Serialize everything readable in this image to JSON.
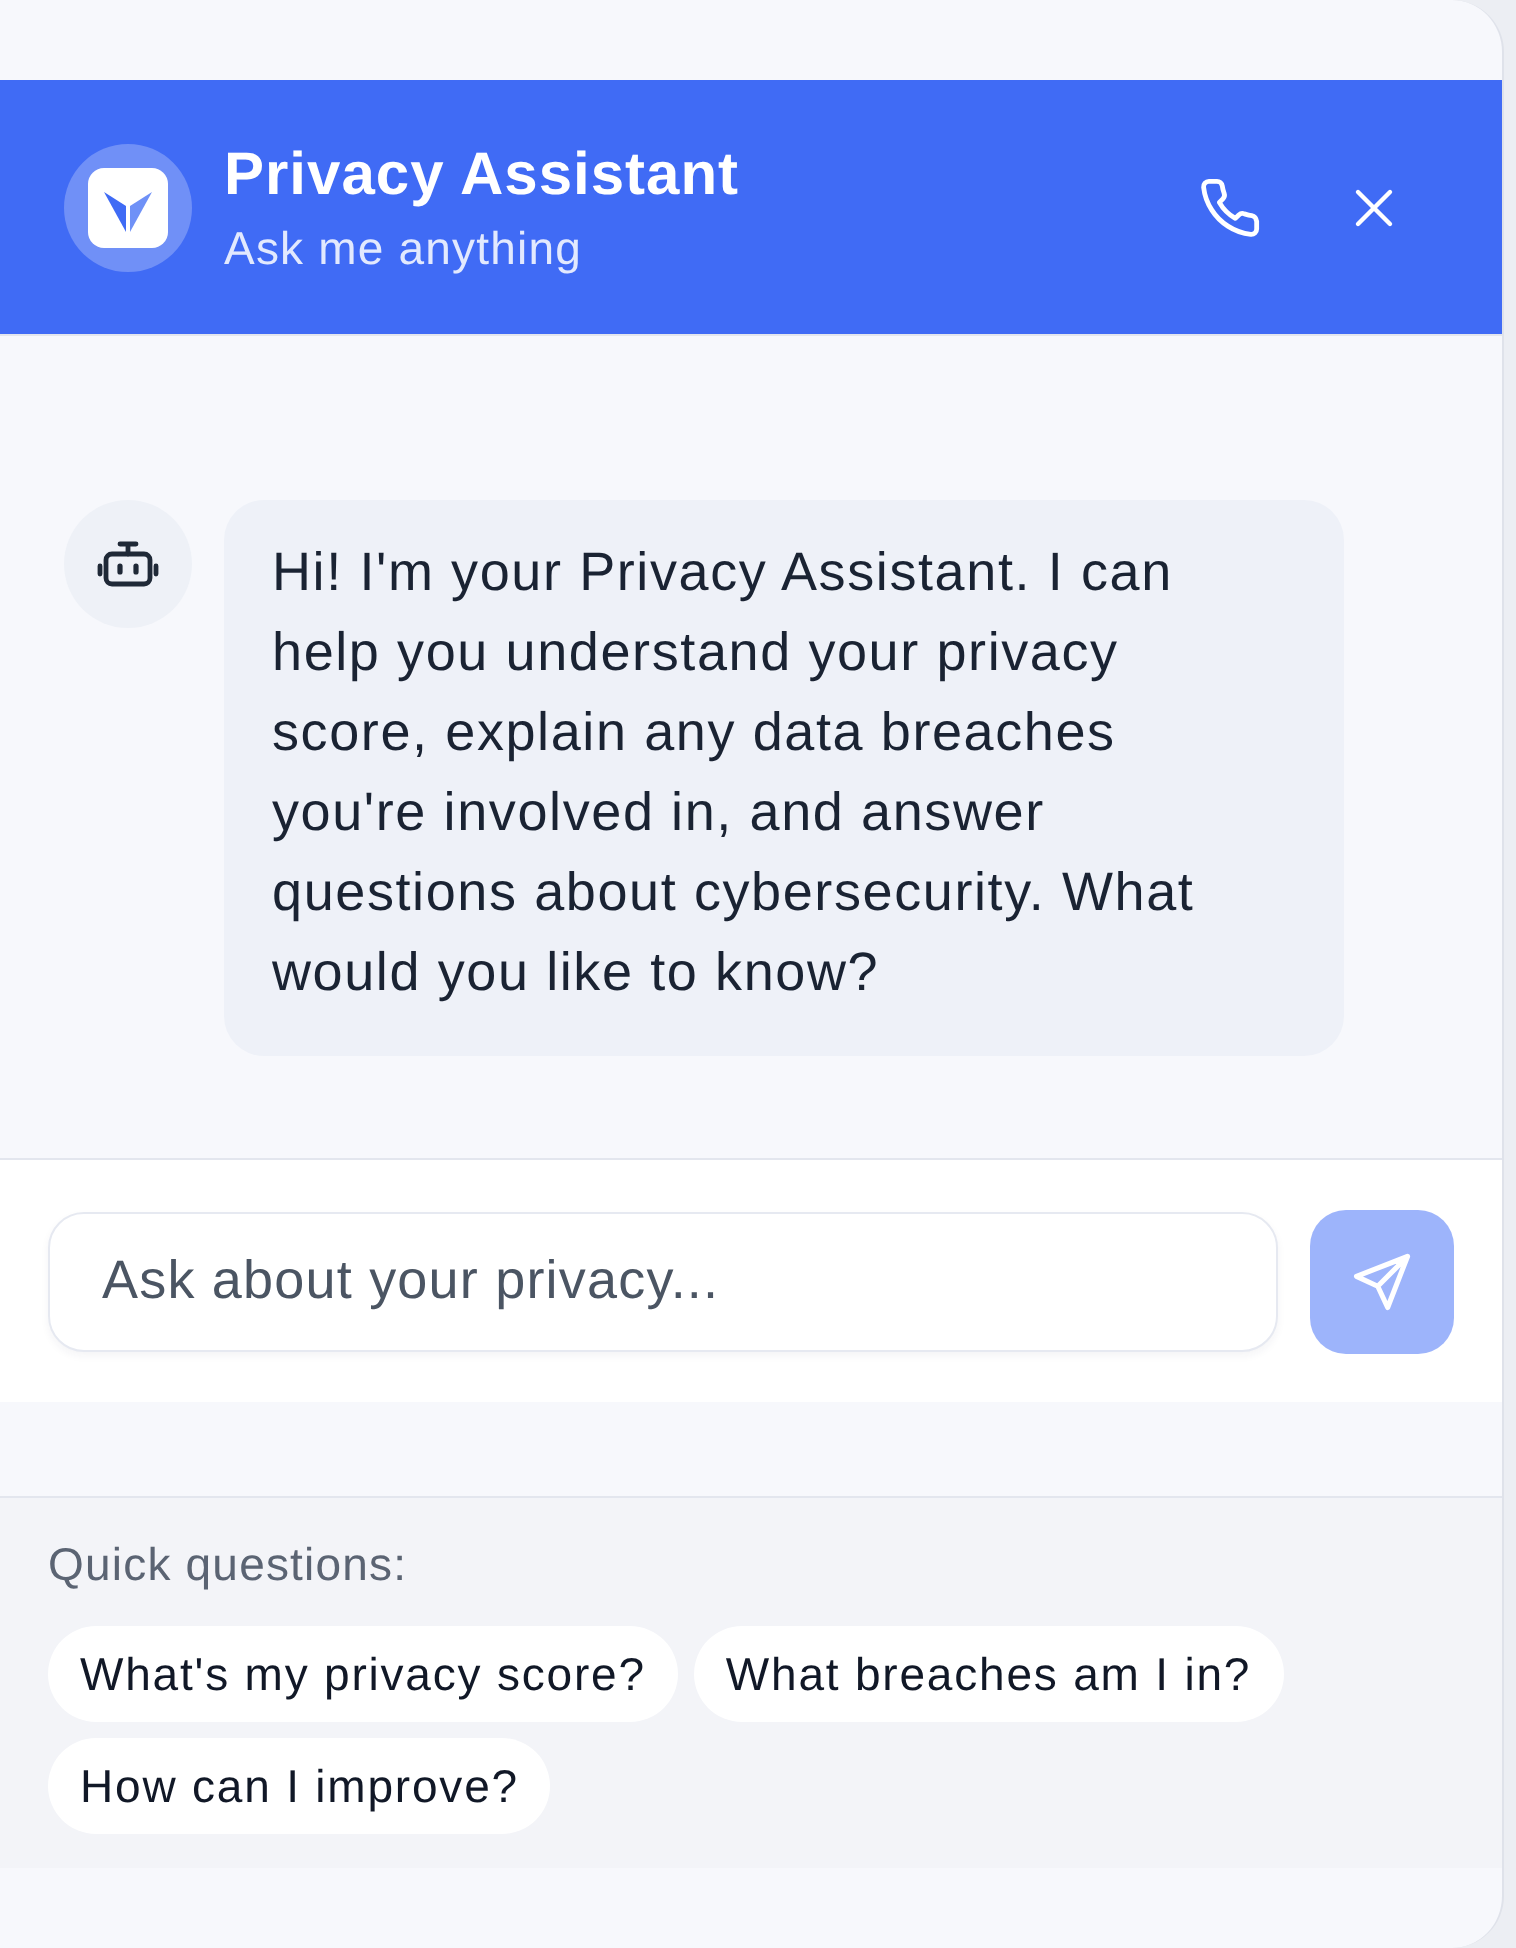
{
  "header": {
    "title": "Privacy Assistant",
    "subtitle": "Ask me anything"
  },
  "messages": [
    {
      "kind": "bot",
      "text": "Hi! I'm your Privacy Assistant. I can help you understand your privacy score, explain any data breaches you're involved in, and answer questions about cybersecurity. What would you like to know?"
    }
  ],
  "composer": {
    "placeholder": "Ask about your privacy...",
    "send_disabled": true
  },
  "quick_questions": {
    "label": "Quick questions:",
    "items": [
      "What's my privacy score?",
      "What breaches am I in?",
      "How can I improve?"
    ]
  }
}
